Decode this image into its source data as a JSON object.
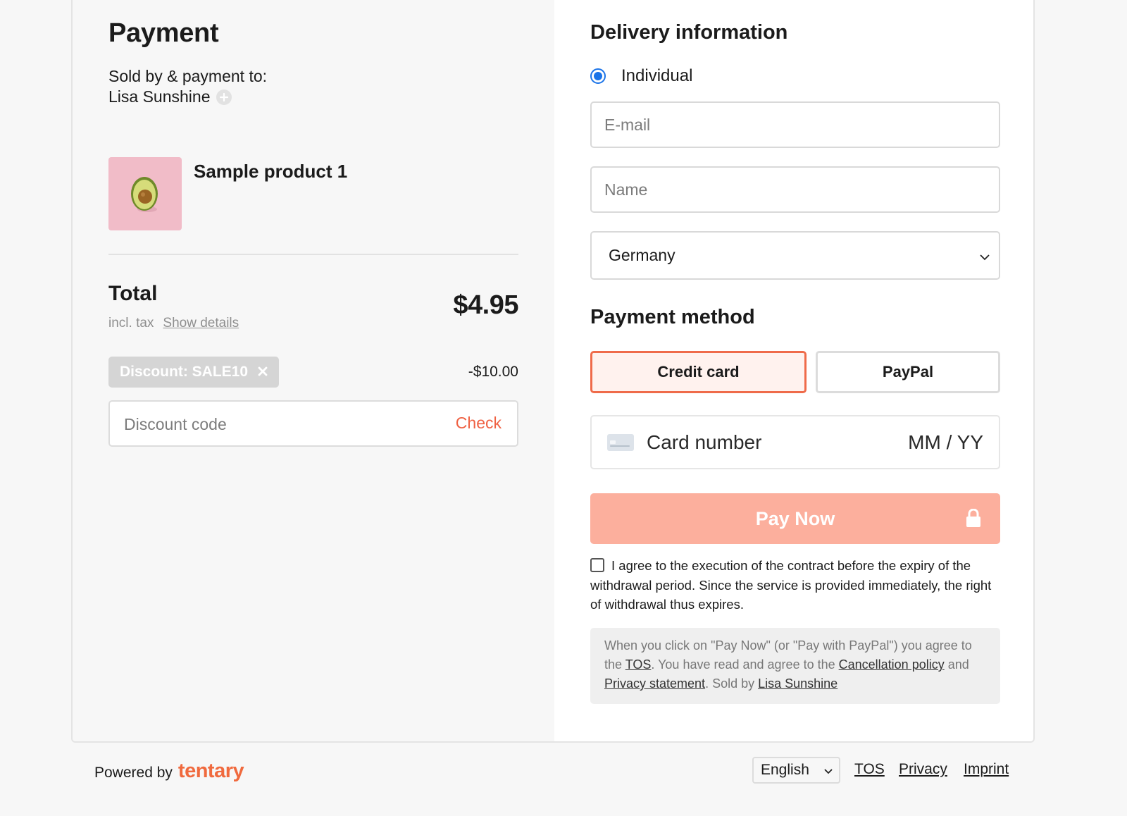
{
  "order": {
    "title": "Payment",
    "sold_by_label": "Sold by & payment to:",
    "seller": "Lisa Sunshine",
    "product_name": "Sample product 1",
    "total_label": "Total",
    "total_amount": "$4.95",
    "incl_tax": "incl. tax",
    "show_details": "Show details",
    "discount_chip": "Discount: SALE10",
    "discount_value": "-$10.00",
    "discount_placeholder": "Discount code",
    "check_label": "Check"
  },
  "delivery": {
    "title": "Delivery information",
    "customer_type": "Individual",
    "email_placeholder": "E-mail",
    "name_placeholder": "Name",
    "country": "Germany"
  },
  "payment": {
    "title": "Payment method",
    "methods": [
      "Credit card",
      "PayPal"
    ],
    "selected_method": "Credit card",
    "card_number_placeholder": "Card number",
    "expiry_placeholder": "MM / YY",
    "pay_label": "Pay Now",
    "agree_text": "I agree to the execution of the contract before the expiry of the withdrawal period. Since the service is provided immediately, the right of withdrawal thus expires.",
    "legal": {
      "part1": "When you click on \"Pay Now\" (or \"Pay with PayPal\") you agree to the ",
      "tos": "TOS",
      "part2": ". You have read and agree to the ",
      "cancellation": "Cancellation policy",
      "part3": " and ",
      "privacy": "Privacy statement",
      "part4": ". Sold by ",
      "seller": "Lisa Sunshine"
    }
  },
  "footer": {
    "powered_by": "Powered by",
    "brand": "tentary",
    "language": "English",
    "tos": "TOS",
    "privacy": "Privacy",
    "imprint": "Imprint"
  },
  "colors": {
    "accent": "#ef6143",
    "pay_button": "#fcaf9d",
    "radio": "#1a73e8"
  }
}
